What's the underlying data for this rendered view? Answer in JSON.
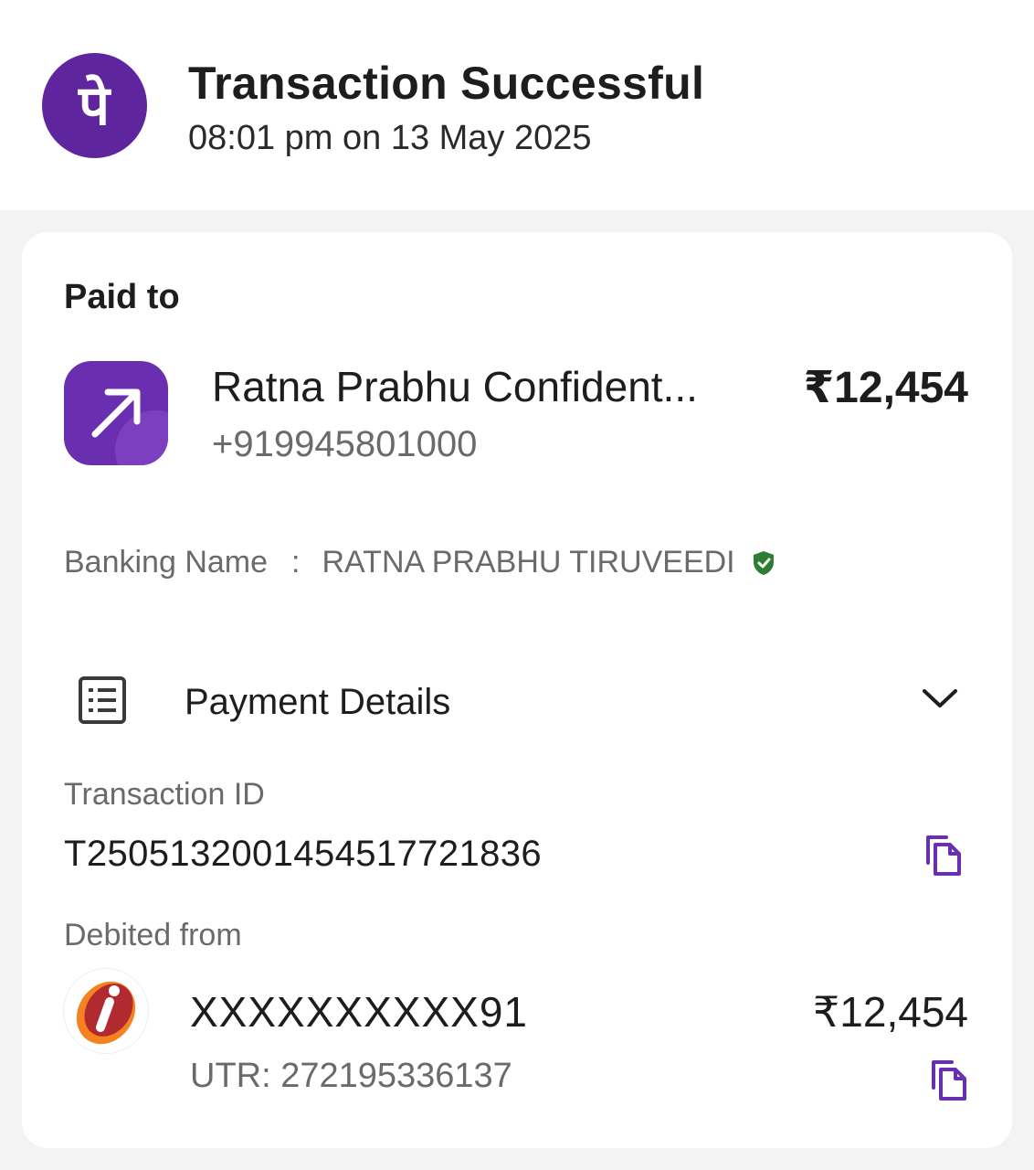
{
  "header": {
    "title": "Transaction Successful",
    "datetime": "08:01 pm on 13 May 2025",
    "logo_glyph": "पे",
    "logo_icon": "phonepe-logo-icon",
    "brand_color": "#5f259f"
  },
  "paid_to": {
    "label": "Paid to",
    "icon": "arrow-up-right-icon",
    "name": "Ratna Prabhu Confident...",
    "phone": "+919945801000",
    "amount": "₹12,454"
  },
  "banking_name": {
    "label": "Banking Name",
    "separator": ":",
    "value": "RATNA PRABHU TIRUVEEDI",
    "verified_icon": "verified-shield-icon",
    "verified_color": "#2e7d32"
  },
  "payment_details": {
    "title": "Payment Details",
    "icon": "receipt-list-icon",
    "toggle_icon": "chevron-down-icon",
    "transaction_id_label": "Transaction ID",
    "transaction_id": "T2505132001454517721836",
    "copy_icon": "copy-icon",
    "debited_from_label": "Debited from",
    "bank_icon": "icici-bank-logo-icon",
    "account": "XXXXXXXXXX91",
    "utr": "UTR: 272195336137",
    "debit_amount": "₹12,454",
    "accent_color": "#6a2fb0"
  }
}
